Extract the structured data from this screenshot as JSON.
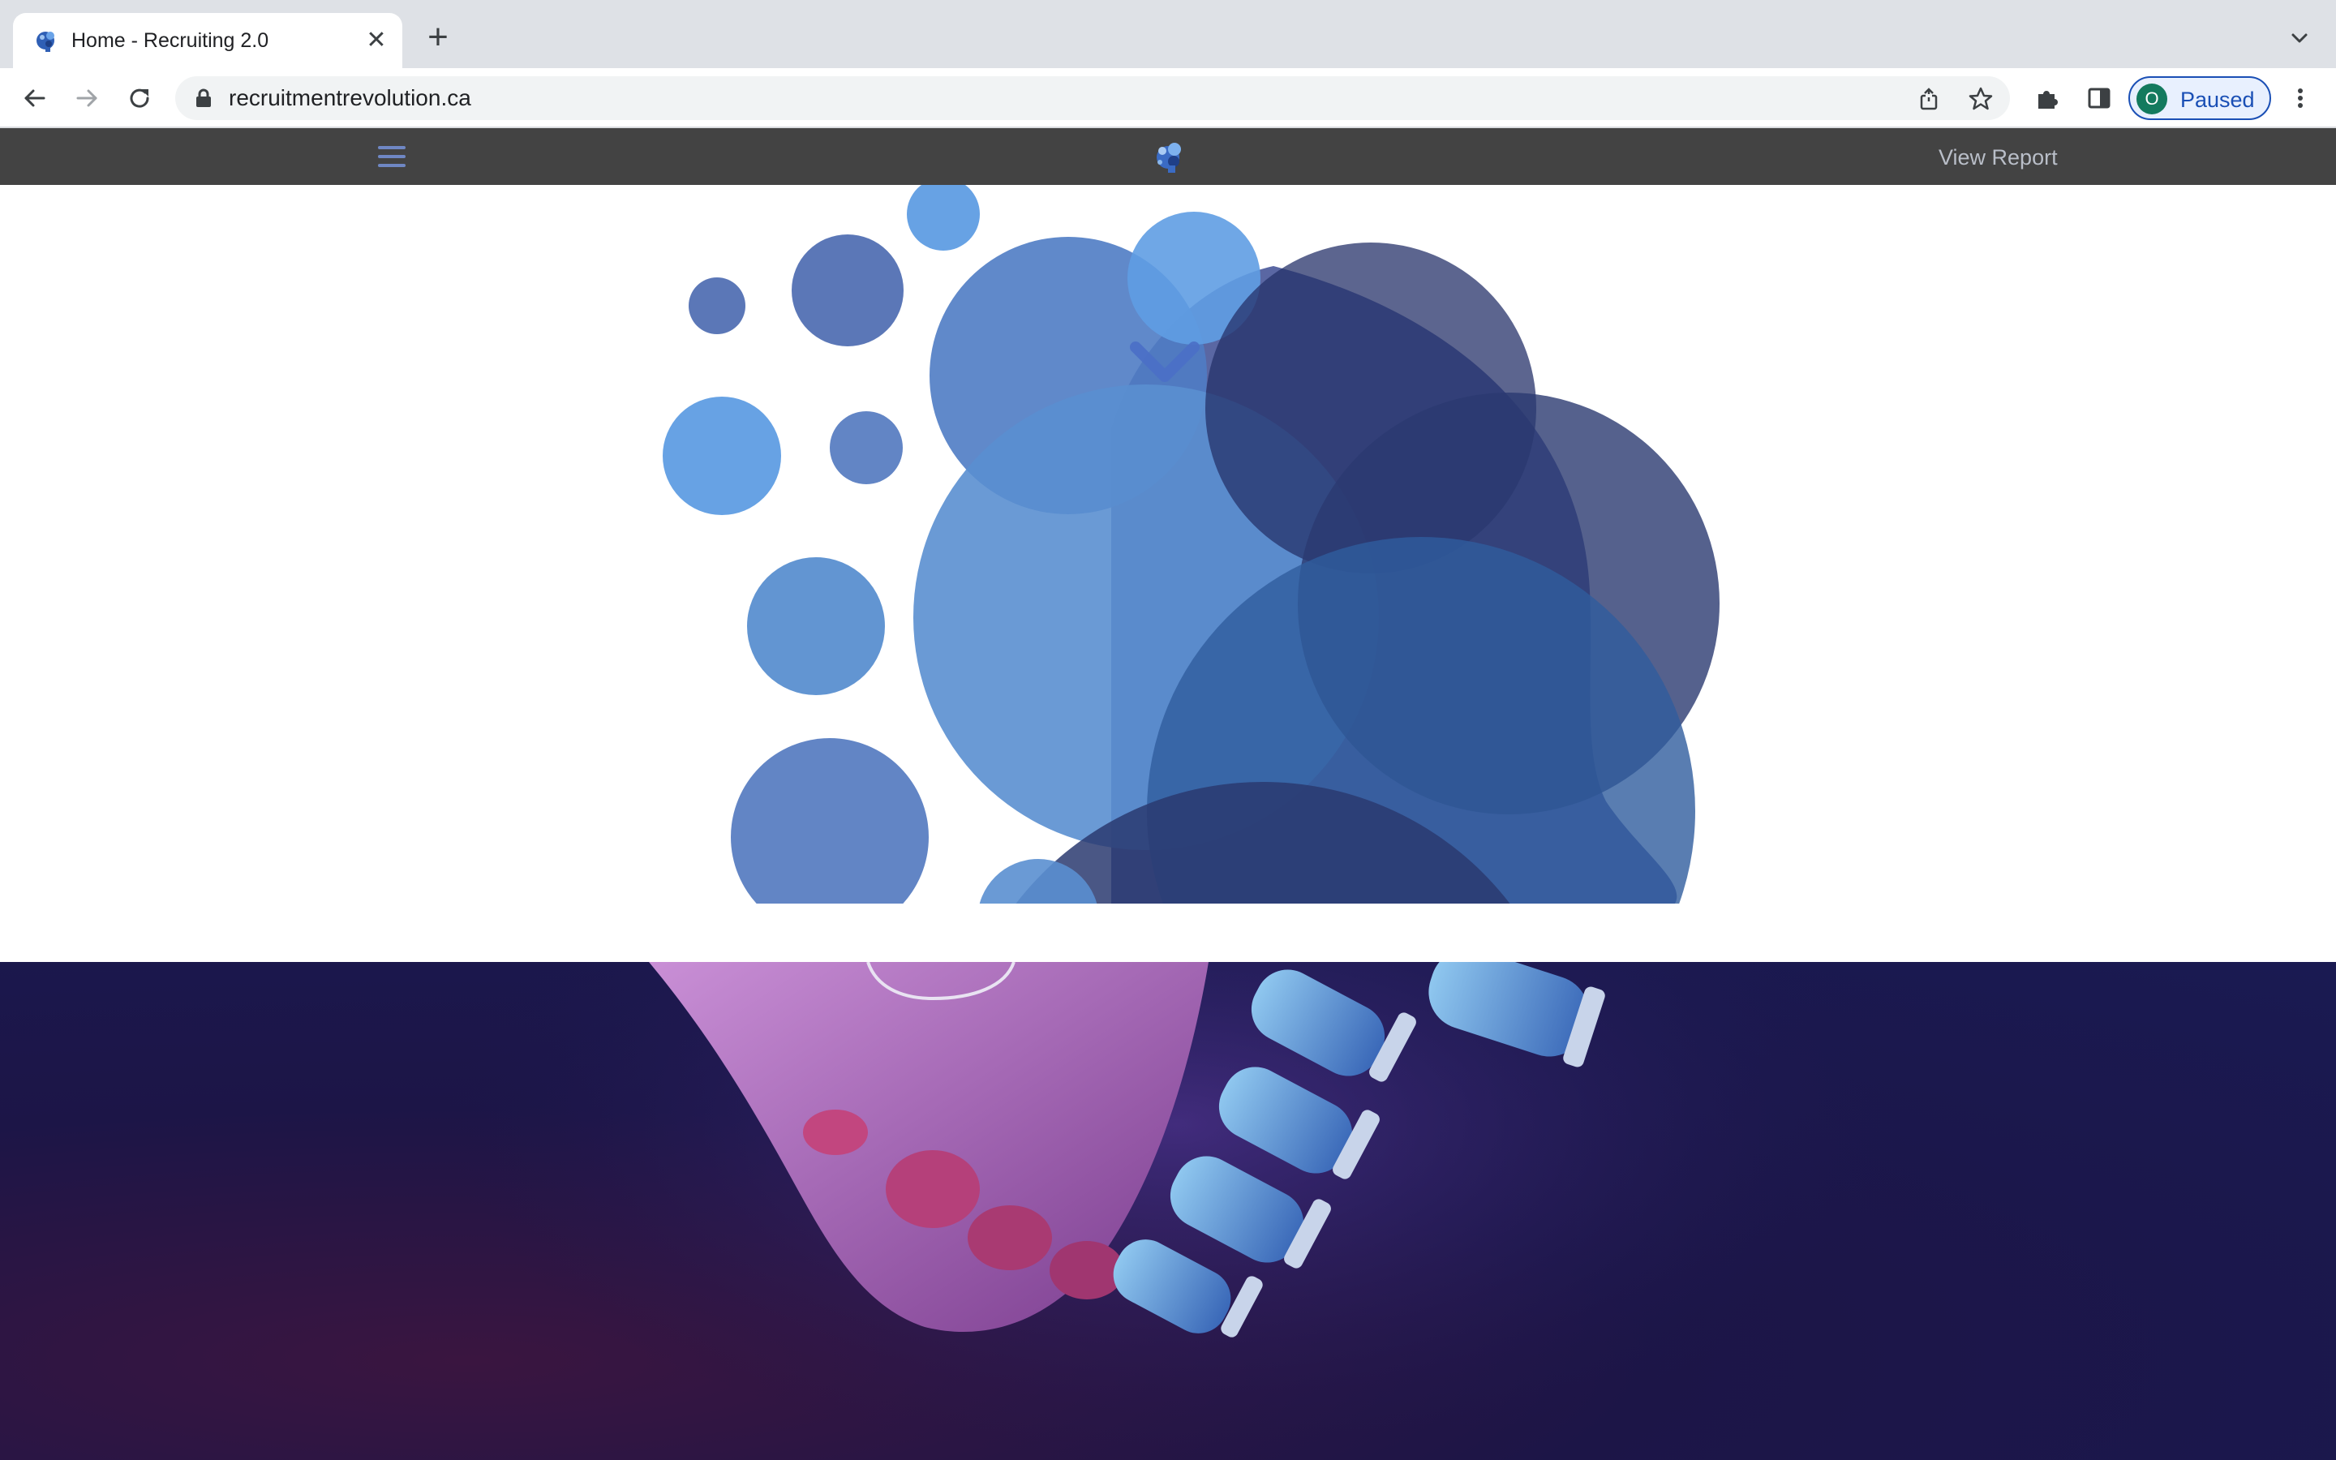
{
  "browser": {
    "tab": {
      "title": "Home - Recruiting 2.0",
      "close_icon": "close-icon",
      "favicon": "brain-logo-icon"
    },
    "new_tab_icon": "plus-icon",
    "tab_search_icon": "chevron-down-icon",
    "nav": {
      "back_icon": "arrow-left-icon",
      "forward_icon": "arrow-right-icon",
      "reload_icon": "reload-icon"
    },
    "omnibox": {
      "url": "recruitmentrevolution.ca",
      "lock_icon": "lock-icon",
      "share_icon": "share-icon",
      "bookmark_icon": "star-icon"
    },
    "extensions_icon": "puzzle-icon",
    "side_panel_icon": "side-panel-icon",
    "profile": {
      "initial": "O",
      "status": "Paused",
      "avatar_color": "#137a5e"
    },
    "menu_icon": "kebab-menu-icon"
  },
  "site_nav": {
    "menu_icon": "hamburger-icon",
    "logo": "brain-logo-icon",
    "view_report": "View Report",
    "background": "#434343"
  },
  "hero": {
    "graphic": "blue-bubbles-head-illustration",
    "scroll_icon": "chevron-down-icon",
    "image": "human-robot-handshake-photo",
    "colors": {
      "light_blue": "#5f9de3",
      "mid_blue": "#5a7ec2",
      "dark_navy": "#2a3a70",
      "slate": "#5a67a3"
    }
  }
}
